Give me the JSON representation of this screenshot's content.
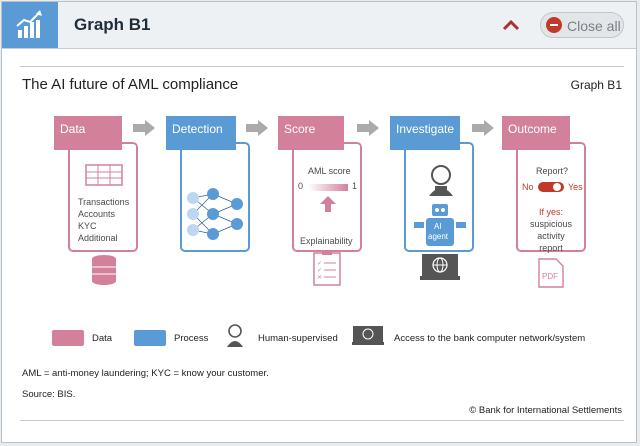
{
  "window": {
    "title": "Graph B1",
    "close_all_label": "Close all"
  },
  "figure": {
    "title": "The AI future of AML compliance",
    "ref": "Graph B1",
    "stages": [
      {
        "label": "Data",
        "kind": "data"
      },
      {
        "label": "Detection",
        "kind": "process"
      },
      {
        "label": "Score",
        "kind": "data"
      },
      {
        "label": "Investigate",
        "kind": "process"
      },
      {
        "label": "Outcome",
        "kind": "data"
      }
    ],
    "data_stage": {
      "items": [
        "Transactions",
        "Accounts",
        "KYC",
        "Additional"
      ]
    },
    "score_stage": {
      "aml_score": "AML score",
      "min": "0",
      "max": "1",
      "explainability": "Explainability"
    },
    "investigate_stage": {
      "agent_label_1": "AI",
      "agent_label_2": "agent"
    },
    "outcome_stage": {
      "report_q": "Report?",
      "no": "No",
      "yes": "Yes",
      "if_yes": "If yes:",
      "r1": "suspicious",
      "r2": "activity",
      "r3": "report",
      "pdf": "PDF"
    },
    "legend": {
      "data": "Data",
      "process": "Process",
      "human": "Human-supervised",
      "network": "Access to the bank computer network/system"
    },
    "note": "AML = anti-money laundering; KYC = know your customer.",
    "source": "Source: BIS.",
    "copyright": "© Bank for International Settlements"
  },
  "colors": {
    "data": "#d3819a",
    "process": "#5b9bd5",
    "accent": "#c0392b"
  }
}
